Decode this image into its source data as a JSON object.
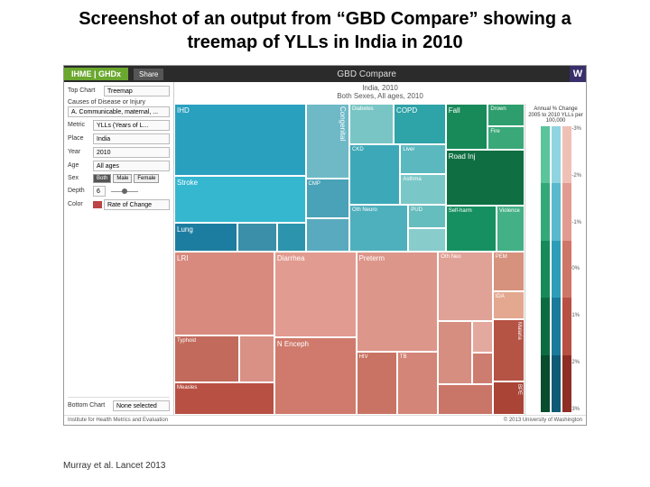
{
  "slide": {
    "title": "Screenshot of an output from “GBD Compare” showing a treemap of YLLs in India in 2010",
    "citation": "Murray et al. Lancet 2013"
  },
  "header": {
    "brand": "IHME | GHDx",
    "share": "Share",
    "title": "GBD Compare",
    "logo": "W"
  },
  "vis_header": {
    "line1": "India, 2010",
    "line2": "Both Sexes, All ages, 2010"
  },
  "sidebar": {
    "top_chart_label": "Top Chart",
    "top_chart_value": "Treemap",
    "cause_label": "Causes of Disease or Injury",
    "cause_value": "A. Communicable, maternal, ...",
    "metric_label": "Metric",
    "metric_value": "YLLs (Years of L...",
    "place_label": "Place",
    "place_value": "India",
    "year_label": "Year",
    "year_value": "2010",
    "age_label": "Age",
    "age_value": "All ages",
    "sex_label": "Sex",
    "sex_opts": [
      "Both",
      "Male",
      "Female"
    ],
    "depth_label": "Depth",
    "depth_value": "6",
    "color_label": "Color",
    "color_value": "Rate of Change",
    "bottom_chart_label": "Bottom Chart",
    "bottom_chart_value": "None selected"
  },
  "treemap": {
    "top": {
      "ncd_blue": {
        "ihd": "IHD",
        "stroke": "Stroke",
        "lung": "Lung",
        "congenital": "Congenital",
        "cmp": "CMP",
        "diabetes": "Diabetes",
        "copd": "COPD",
        "ckd": "CKD",
        "liver": "Liver",
        "asthma": "Asthma",
        "oth_neuro": "Oth Neuro",
        "pud": "PUD"
      },
      "injury_green": {
        "fall": "Fall",
        "drown": "Drown",
        "fire": "Fire",
        "road_inj": "Road Inj",
        "self_harm": "Self-harm",
        "violence": "Violence"
      }
    },
    "bot": {
      "lri": "LRI",
      "diarrhea": "Diarrhea",
      "preterm": "Preterm",
      "n_enceph": "N Enceph",
      "typhoid": "Typhoid",
      "measles": "Measles",
      "hiv": "HIV",
      "tb": "TB",
      "oth_neo": "Oth Neo",
      "malaria": "Malaria",
      "pem": "PEM",
      "ida": "IDA",
      "bpe": "BPE"
    }
  },
  "legend": {
    "title": "Annual % Change 2005 to 2010 YLLs per 100,000",
    "ticks": [
      "-3%",
      "-2%",
      "-1%",
      "0%",
      "1%",
      "2%",
      "3%"
    ]
  },
  "footer": {
    "left": "Institute for Health Metrics and Evaluation",
    "right": "© 2013 University of Washington"
  }
}
